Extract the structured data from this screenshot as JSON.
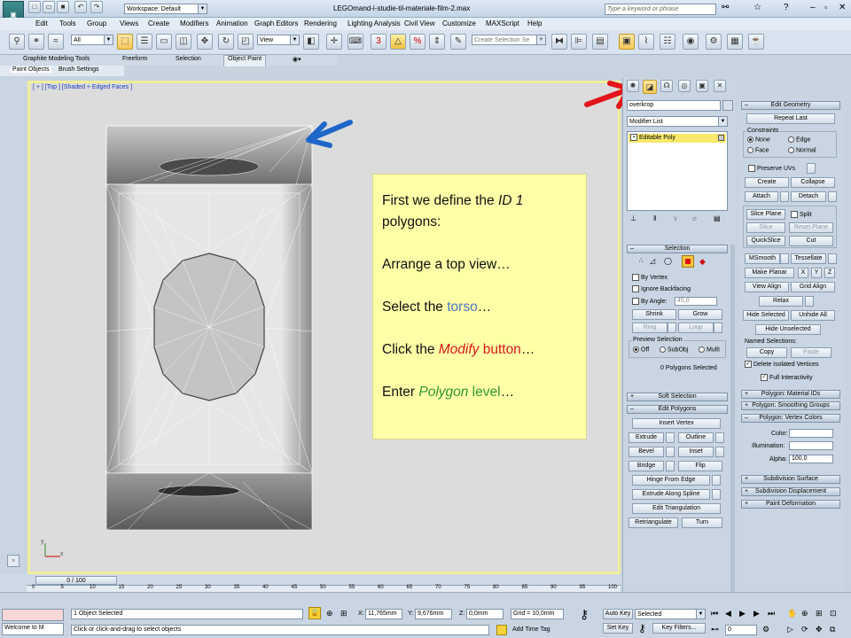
{
  "window": {
    "workspace": "Workspace: Default",
    "title": "LEGOmand-i-studie-til-materiale-film-2.max",
    "search_placeholder": "Type a keyword or phrase"
  },
  "menu": [
    "Edit",
    "Tools",
    "Group",
    "Views",
    "Create",
    "Modifiers",
    "Animation",
    "Graph Editors",
    "Rendering",
    "Lighting Analysis",
    "Civil View",
    "Customize",
    "MAXScript",
    "Help"
  ],
  "toolbar": {
    "filter_value": "All",
    "coord_value": "View",
    "selection_set_placeholder": "Create Selection Se"
  },
  "ribbon": {
    "tabs": [
      "Graphite Modeling Tools",
      "Freeform",
      "Selection",
      "Object Paint"
    ],
    "subtabs": [
      "Paint Objects",
      "Brush Settings"
    ]
  },
  "viewport": {
    "label": "[ + ] [Top ] [Shaded + Edged Faces ]",
    "axis_x": "x",
    "axis_y": "y"
  },
  "callout": {
    "line1_pre": "First we define the ",
    "line1_em": "ID 1",
    "line1_post": " polygons:",
    "line2": "Arrange a top view…",
    "line3_pre": "Select the ",
    "line3_word": "torso",
    "line3_post": "…",
    "line4_pre": "Click the ",
    "line4_em": "Modify",
    "line4_word": " button",
    "line4_post": "…",
    "line5_pre": "Enter ",
    "line5_em": "Polygon",
    "line5_word": " level",
    "line5_post": "…",
    "colors": {
      "torso": "#4a78c0",
      "modify": "#d4161c",
      "polygon": "#2e9a2e"
    }
  },
  "modify_panel": {
    "object_name": "overkrop",
    "modifier_list": "Modifier List",
    "stack_item": "Editable Poly",
    "selection": {
      "header": "Selection",
      "by_vertex": "By Vertex",
      "ignore_backfacing": "Ignore Backfacing",
      "by_angle": "By Angle:",
      "angle_value": "45,0",
      "shrink": "Shrink",
      "grow": "Grow",
      "ring": "Ring",
      "loop": "Loop",
      "preview_selection": "Preview Selection",
      "off": "Off",
      "subobj": "SubObj",
      "multi": "Multi",
      "status": "0 Polygons Selected"
    },
    "soft_selection": "Soft Selection",
    "edit_polygons": {
      "header": "Edit Polygons",
      "insert_vertex": "Insert Vertex",
      "extrude": "Extrude",
      "outline": "Outline",
      "bevel": "Bevel",
      "inset": "Inset",
      "bridge": "Bridge",
      "flip": "Flip",
      "hinge": "Hinge From Edge",
      "extrude_spline": "Extrude Along Spline",
      "edit_triangulation": "Edit Triangulation",
      "retriangulate": "Retriangulate",
      "turn": "Turn"
    }
  },
  "edit_geometry": {
    "header": "Edit Geometry",
    "repeat_last": "Repeat Last",
    "constraints": "Constraints",
    "none": "None",
    "edge": "Edge",
    "face": "Face",
    "normal": "Normal",
    "preserve_uvs": "Preserve UVs",
    "create": "Create",
    "collapse": "Collapse",
    "attach": "Attach",
    "detach": "Detach",
    "slice_plane": "Slice Plane",
    "split": "Split",
    "slice": "Slice",
    "reset_plane": "Reset Plane",
    "quickslice": "QuickSlice",
    "cut": "Cut",
    "msmooth": "MSmooth",
    "tessellate": "Tessellate",
    "make_planar": "Make Planar",
    "x": "X",
    "y": "Y",
    "z": "Z",
    "view_align": "View Align",
    "grid_align": "Grid Align",
    "relax": "Relax",
    "hide_selected": "Hide Selected",
    "unhide_all": "Unhide All",
    "hide_unselected": "Hide Unselected",
    "named_selections": "Named Selections:",
    "copy": "Copy",
    "paste": "Paste",
    "delete_isolated": "Delete Isolated Vertices",
    "full_interactivity": "Full Interactivity",
    "material_ids": "Polygon: Material IDs",
    "smoothing_groups": "Polygon: Smoothing Groups",
    "vertex_colors": "Polygon: Vertex Colors",
    "color": "Color:",
    "illumination": "Illumination:",
    "alpha": "Alpha:",
    "alpha_value": "100,0",
    "subdivision_surface": "Subdivision Surface",
    "subdivision_displacement": "Subdivision Displacement",
    "paint_deformation": "Paint Deformation"
  },
  "timeline": {
    "frame": "0 / 100",
    "ticks": [
      "0",
      "5",
      "10",
      "15",
      "20",
      "25",
      "30",
      "35",
      "40",
      "45",
      "50",
      "55",
      "60",
      "65",
      "70",
      "75",
      "80",
      "85",
      "90",
      "95",
      "100"
    ]
  },
  "status": {
    "listener": "Welcome to M",
    "objects": "1 Object Selected",
    "prompt": "Click or click-and-drag to select objects",
    "x_label": "X:",
    "x_value": "11,765mm",
    "y_label": "Y:",
    "y_value": "9,676mm",
    "z_label": "Z:",
    "z_value": "0,0mm",
    "grid": "Grid = 10,0mm",
    "add_time_tag": "Add Time Tag",
    "auto_key": "Auto Key",
    "set_key": "Set Key",
    "selected": "Selected",
    "key_filters": "Key Filters...",
    "current_frame": "0"
  }
}
